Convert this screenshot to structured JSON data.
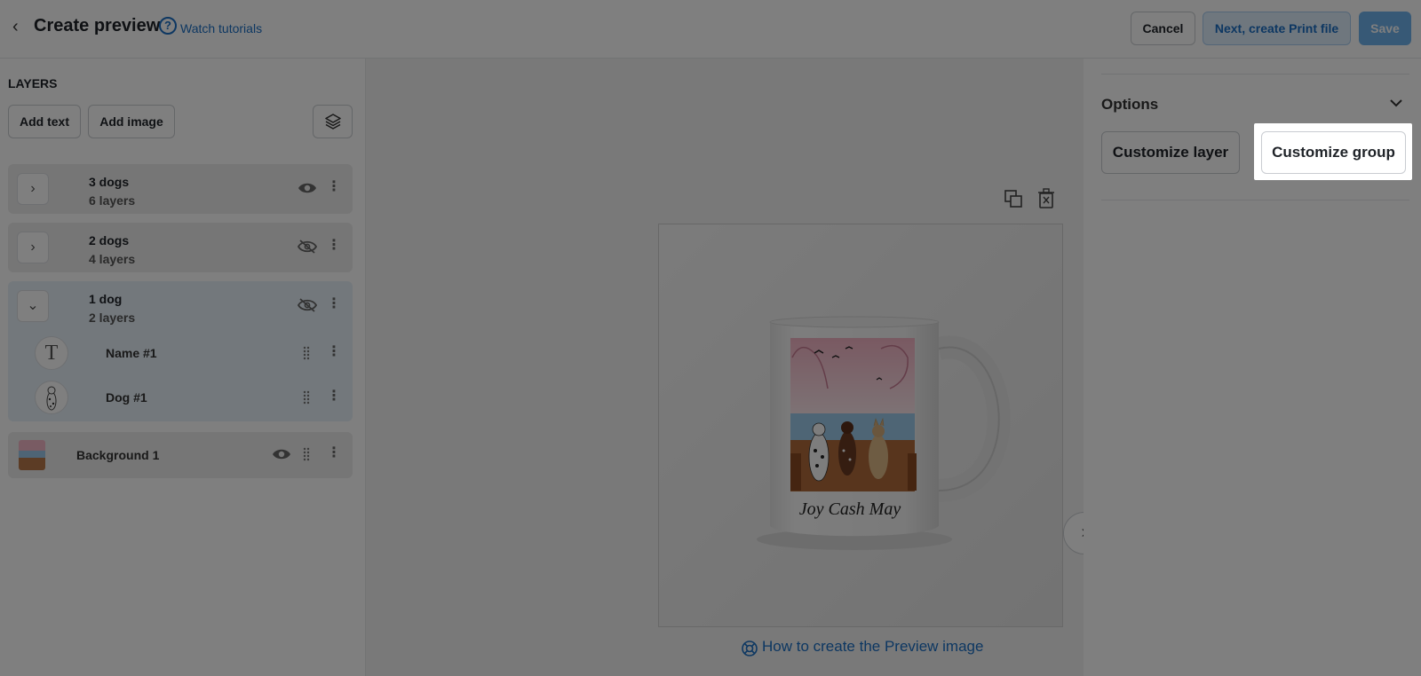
{
  "header": {
    "title": "Create preview",
    "help_label": "Watch tutorials",
    "cancel": "Cancel",
    "next": "Next, create Print file",
    "save": "Save"
  },
  "layers": {
    "heading": "LAYERS",
    "add_text": "Add text",
    "add_image": "Add image",
    "groups": [
      {
        "name": "3 dogs",
        "sub": "6 layers",
        "visible": true,
        "expanded": false
      },
      {
        "name": "2 dogs",
        "sub": "4 layers",
        "visible": false,
        "expanded": false
      },
      {
        "name": "1 dog",
        "sub": "2 layers",
        "visible": false,
        "expanded": true,
        "children": [
          {
            "name": "Name #1",
            "type": "text"
          },
          {
            "name": "Dog #1",
            "type": "image"
          }
        ]
      }
    ],
    "background": {
      "name": "Background 1",
      "visible": true
    }
  },
  "canvas": {
    "mug_names": "Joy Cash May",
    "howto": "How to create the Preview image"
  },
  "options": {
    "title": "Options",
    "customize_layer": "Customize layer",
    "customize_group": "Customize group"
  }
}
